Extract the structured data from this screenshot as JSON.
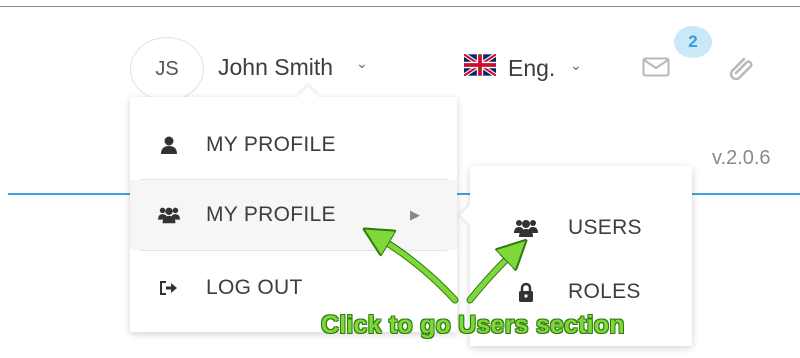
{
  "header": {
    "avatar_initials": "JS",
    "user_name": "John Smith",
    "language_label": "Eng.",
    "notification_count": "2",
    "version": "v.2.0.6"
  },
  "icons": {
    "user_chevron": "chevron-down-icon",
    "language_flag": "uk-flag-icon",
    "mail": "mail-icon",
    "attachment": "paperclip-icon"
  },
  "user_menu": {
    "items": [
      {
        "label": "MY PROFILE",
        "icon": "user-icon"
      },
      {
        "label": "MY PROFILE",
        "icon": "users-icon",
        "has_submenu": true
      },
      {
        "label": "LOG OUT",
        "icon": "logout-icon"
      }
    ]
  },
  "submenu": {
    "items": [
      {
        "label": "USERS",
        "icon": "users-icon"
      },
      {
        "label": "ROLES",
        "icon": "lock-icon"
      }
    ]
  },
  "annotation": {
    "text": "Click to go Users section"
  },
  "colors": {
    "accent_blue": "#3ea3e0",
    "badge_bg": "#c9e8f8",
    "annotation_green": "#7fd83a",
    "annotation_outline": "#2f7a0e"
  }
}
